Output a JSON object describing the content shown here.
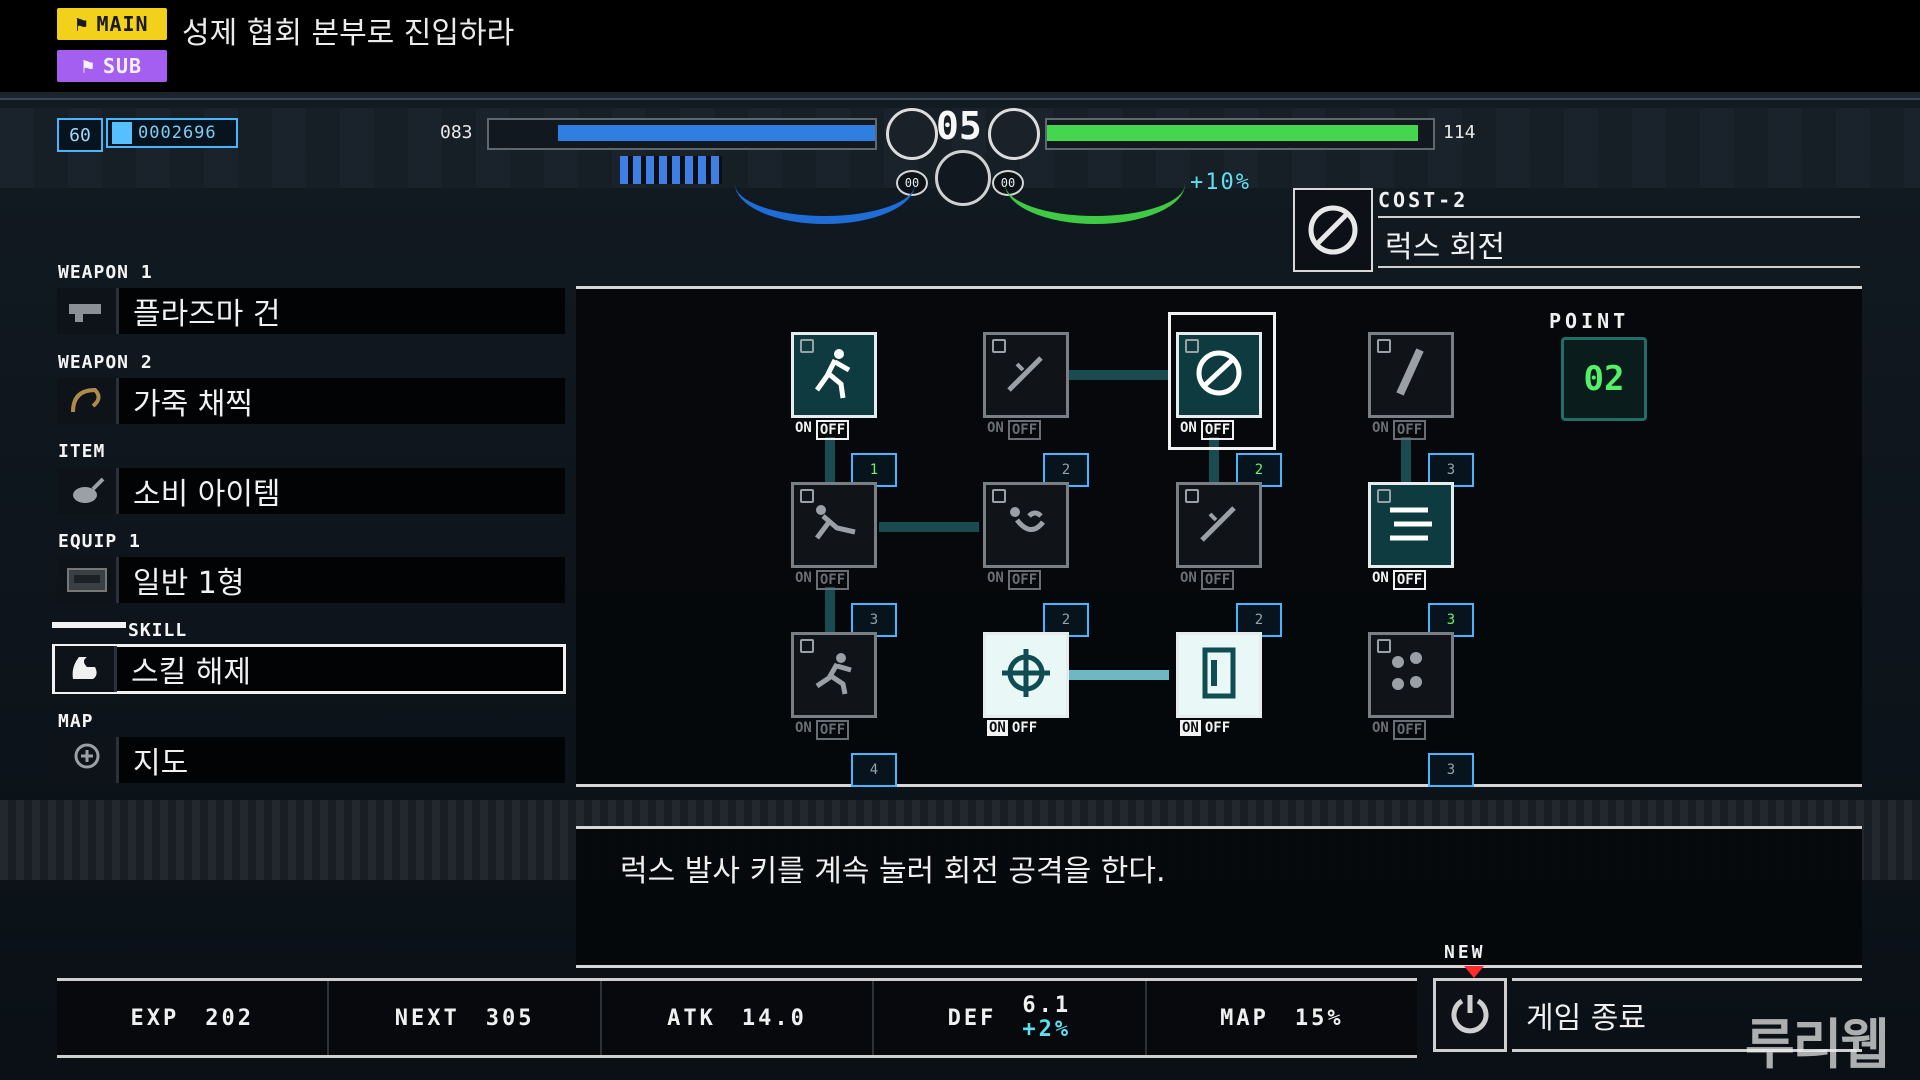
{
  "objectives": {
    "main_badge": "MAIN",
    "sub_badge": "SUB",
    "main_text": "성제 협회 본부로 진입하라"
  },
  "hud": {
    "level": "60",
    "score": "0002696",
    "hp_left": "083",
    "combo": "05",
    "hp_right": "114",
    "counter_left": "00",
    "counter_right": "00",
    "bonus": "+10%",
    "hp_left_fraction": 0.82,
    "hp_right_fraction": 0.96
  },
  "cost": {
    "header": "COST-2",
    "skill_name": "럭스 회전"
  },
  "menu": {
    "weapon1": {
      "label": "WEAPON 1",
      "value": "플라즈마 건"
    },
    "weapon2": {
      "label": "WEAPON 2",
      "value": "가죽 채찍"
    },
    "item": {
      "label": "ITEM",
      "value": "소비 아이템"
    },
    "equip1": {
      "label": "EQUIP 1",
      "value": "일반 1형"
    },
    "skill": {
      "label": "SKILL",
      "value": "스킬 해제"
    },
    "map": {
      "label": "MAP",
      "value": "지도"
    }
  },
  "skills": {
    "on_label": "ON",
    "off_label": "OFF",
    "nodes": [
      {
        "icon": "running-figure-icon",
        "level": "1"
      },
      {
        "icon": "sword-slash-icon",
        "level": "2"
      },
      {
        "icon": "lux-spin-icon",
        "level": "2"
      },
      {
        "icon": "blade-strike-icon",
        "level": "3"
      },
      {
        "icon": "slide-figure-icon",
        "level": "3"
      },
      {
        "icon": "dash-roll-icon",
        "level": "2"
      },
      {
        "icon": "sword-slash-icon",
        "level": "2"
      },
      {
        "icon": "triple-knife-icon",
        "level": "3"
      },
      {
        "icon": "sprint-figure-icon",
        "level": "4"
      },
      {
        "icon": "crosshair-icon",
        "level": ""
      },
      {
        "icon": "door-icon",
        "level": ""
      },
      {
        "icon": "droplets-icon",
        "level": "3"
      }
    ],
    "point_label": "POINT",
    "point_value": "02"
  },
  "description": "럭스 발사 키를 계속 눌러 회전 공격을 한다.",
  "status": {
    "exp_label": "EXP",
    "exp_value": "202",
    "next_label": "NEXT",
    "next_value": "305",
    "atk_label": "ATK",
    "atk_value": "14.0",
    "def_label": "DEF",
    "def_value": "6.1",
    "def_bonus": "+2%",
    "map_label": "MAP",
    "map_value": "15%"
  },
  "quit": {
    "new_label": "NEW",
    "label": "게임 종료"
  },
  "watermark": "루리웹",
  "colors": {
    "main_badge": "#f3d11a",
    "sub_badge": "#a55ff0",
    "hp_left": "#2f7fe3",
    "hp_right": "#45d64f",
    "point": "#55f06a",
    "bonus": "#5fe0f0"
  }
}
